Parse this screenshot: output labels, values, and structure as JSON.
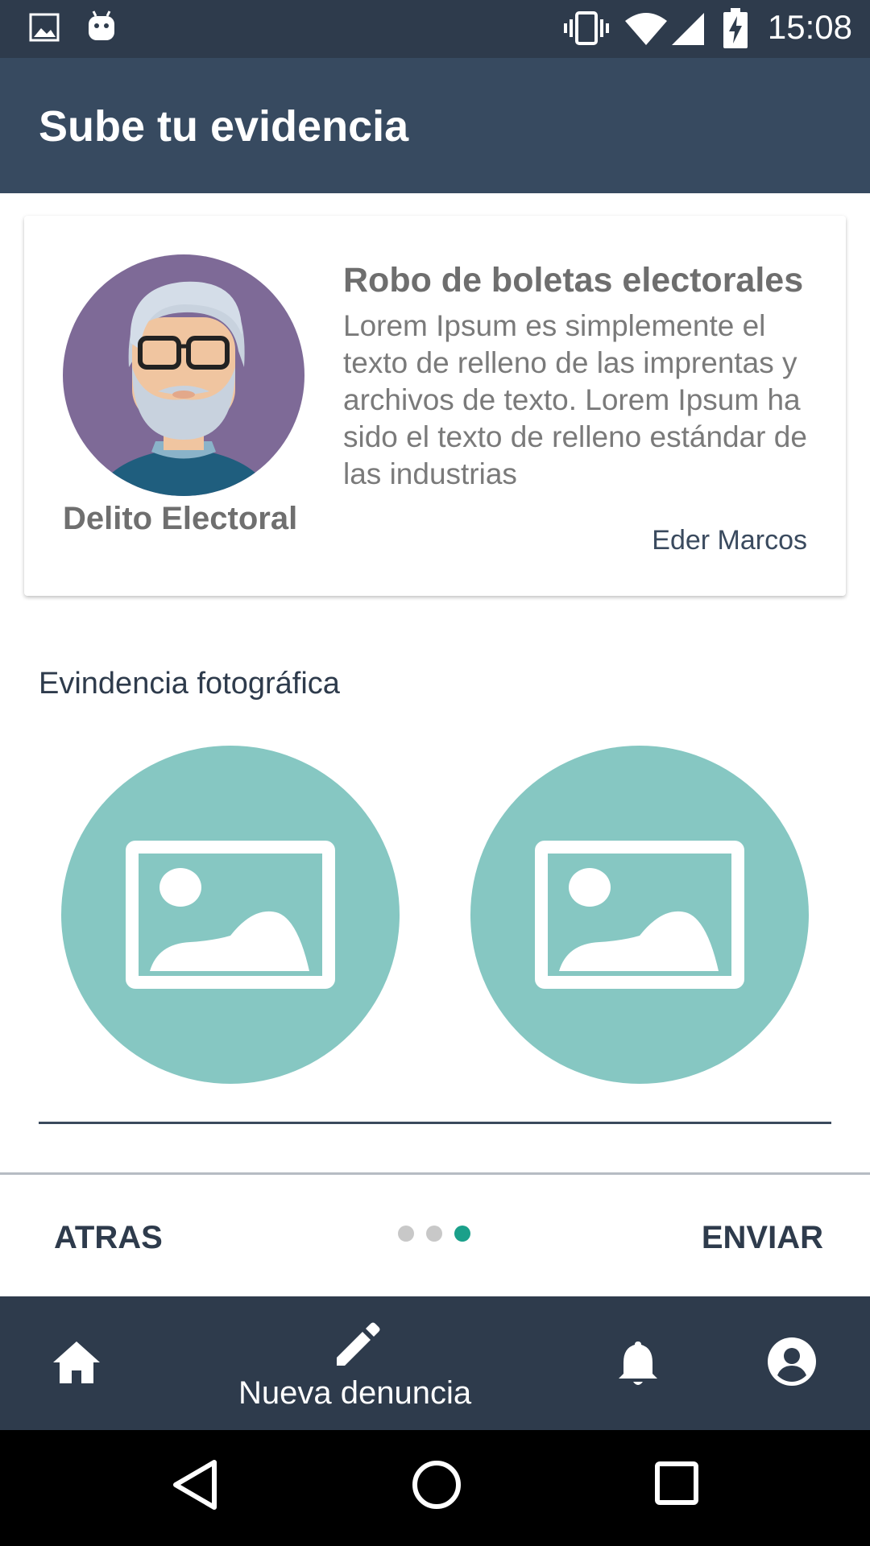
{
  "status_bar": {
    "time": "15:08",
    "icons": [
      "image-icon",
      "android-icon",
      "vibrate-icon",
      "wifi-icon",
      "signal-icon",
      "battery-charging-icon"
    ]
  },
  "app_bar": {
    "title": "Sube tu evidencia"
  },
  "report_card": {
    "avatar": "avatar-old-man-glasses",
    "category": "Delito Electoral",
    "title": "Robo de boletas electorales",
    "description": "Lorem Ipsum es simplemente el texto de relleno de las imprentas y archivos de texto. Lorem Ipsum ha sido el texto de relleno estándar de las industrias",
    "author": "Eder Marcos"
  },
  "evidence": {
    "label": "Evindencia fotográfica",
    "slots": [
      {
        "icon": "image-placeholder-icon"
      },
      {
        "icon": "image-placeholder-icon"
      }
    ]
  },
  "stepper": {
    "back_label": "ATRAS",
    "send_label": "ENVIAR",
    "steps_total": 3,
    "current_step": 3
  },
  "bottom_nav": {
    "items": [
      {
        "icon": "home-icon"
      },
      {
        "icon": "pencil-icon",
        "label": "Nueva denuncia",
        "active": true
      },
      {
        "icon": "bell-icon"
      },
      {
        "icon": "account-icon"
      }
    ]
  },
  "colors": {
    "status_bar": "#2e3b4c",
    "app_bar": "#374a60",
    "accent_teal": "#86c7c2",
    "active_dot": "#1aa08a",
    "inactive_dot": "#c8c8c8"
  }
}
